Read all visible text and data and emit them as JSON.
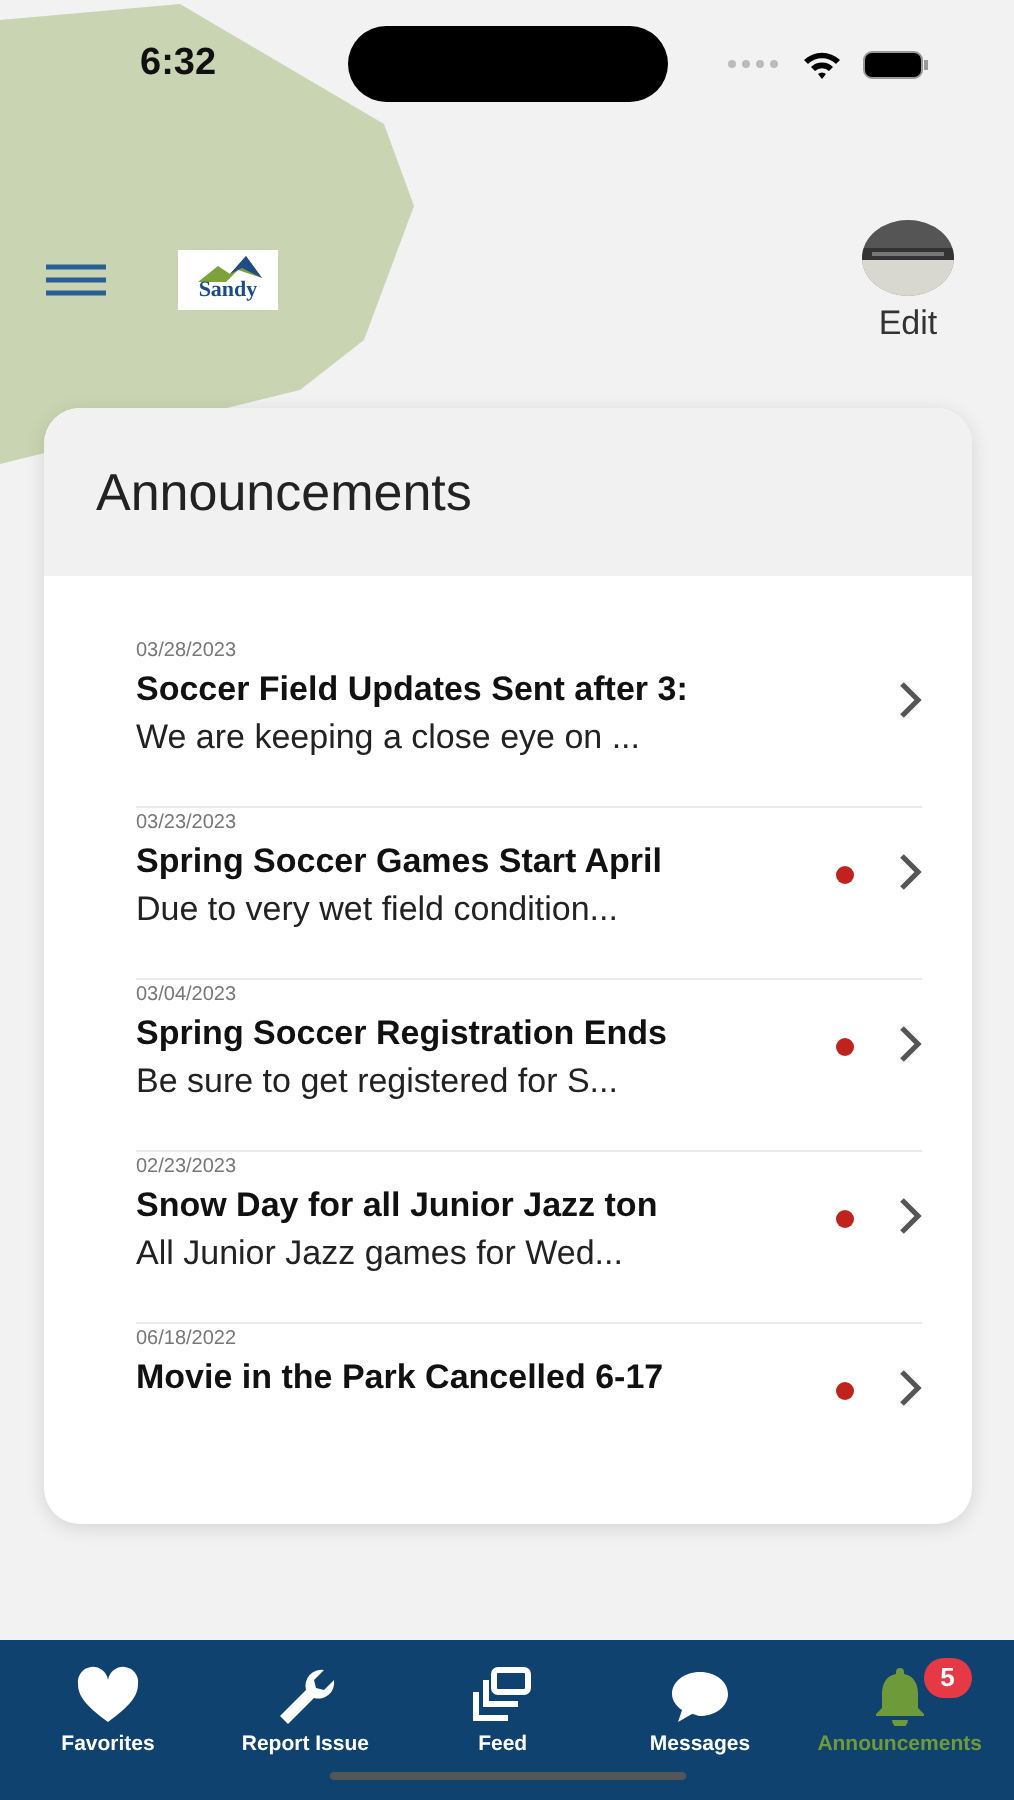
{
  "status_bar": {
    "time": "6:32"
  },
  "header": {
    "logo_text": "Sandy",
    "profile_label": "Edit"
  },
  "card": {
    "title": "Announcements",
    "items": [
      {
        "date": "03/28/2023",
        "title": "Soccer Field Updates Sent after 3:",
        "subtitle": "We are keeping a close eye on ...",
        "unread": false
      },
      {
        "date": "03/23/2023",
        "title": "Spring Soccer Games Start April",
        "subtitle": "Due to very wet field condition...",
        "unread": true
      },
      {
        "date": "03/04/2023",
        "title": "Spring Soccer Registration Ends",
        "subtitle": "Be sure to get registered for S...",
        "unread": true
      },
      {
        "date": "02/23/2023",
        "title": "Snow Day for all Junior Jazz ton",
        "subtitle": "All Junior Jazz games for Wed...",
        "unread": true
      },
      {
        "date": "06/18/2022",
        "title": "Movie in the Park Cancelled 6-17",
        "unread": true
      }
    ]
  },
  "tab_bar": [
    {
      "kind": "heart",
      "label": "Favorites",
      "selected": false
    },
    {
      "kind": "wrench",
      "label": "Report Issue",
      "selected": false
    },
    {
      "kind": "feed",
      "label": "Feed",
      "selected": false
    },
    {
      "kind": "chat",
      "label": "Messages",
      "selected": false
    },
    {
      "kind": "bell",
      "label": "Announcements",
      "selected": true,
      "badge": "5"
    }
  ]
}
